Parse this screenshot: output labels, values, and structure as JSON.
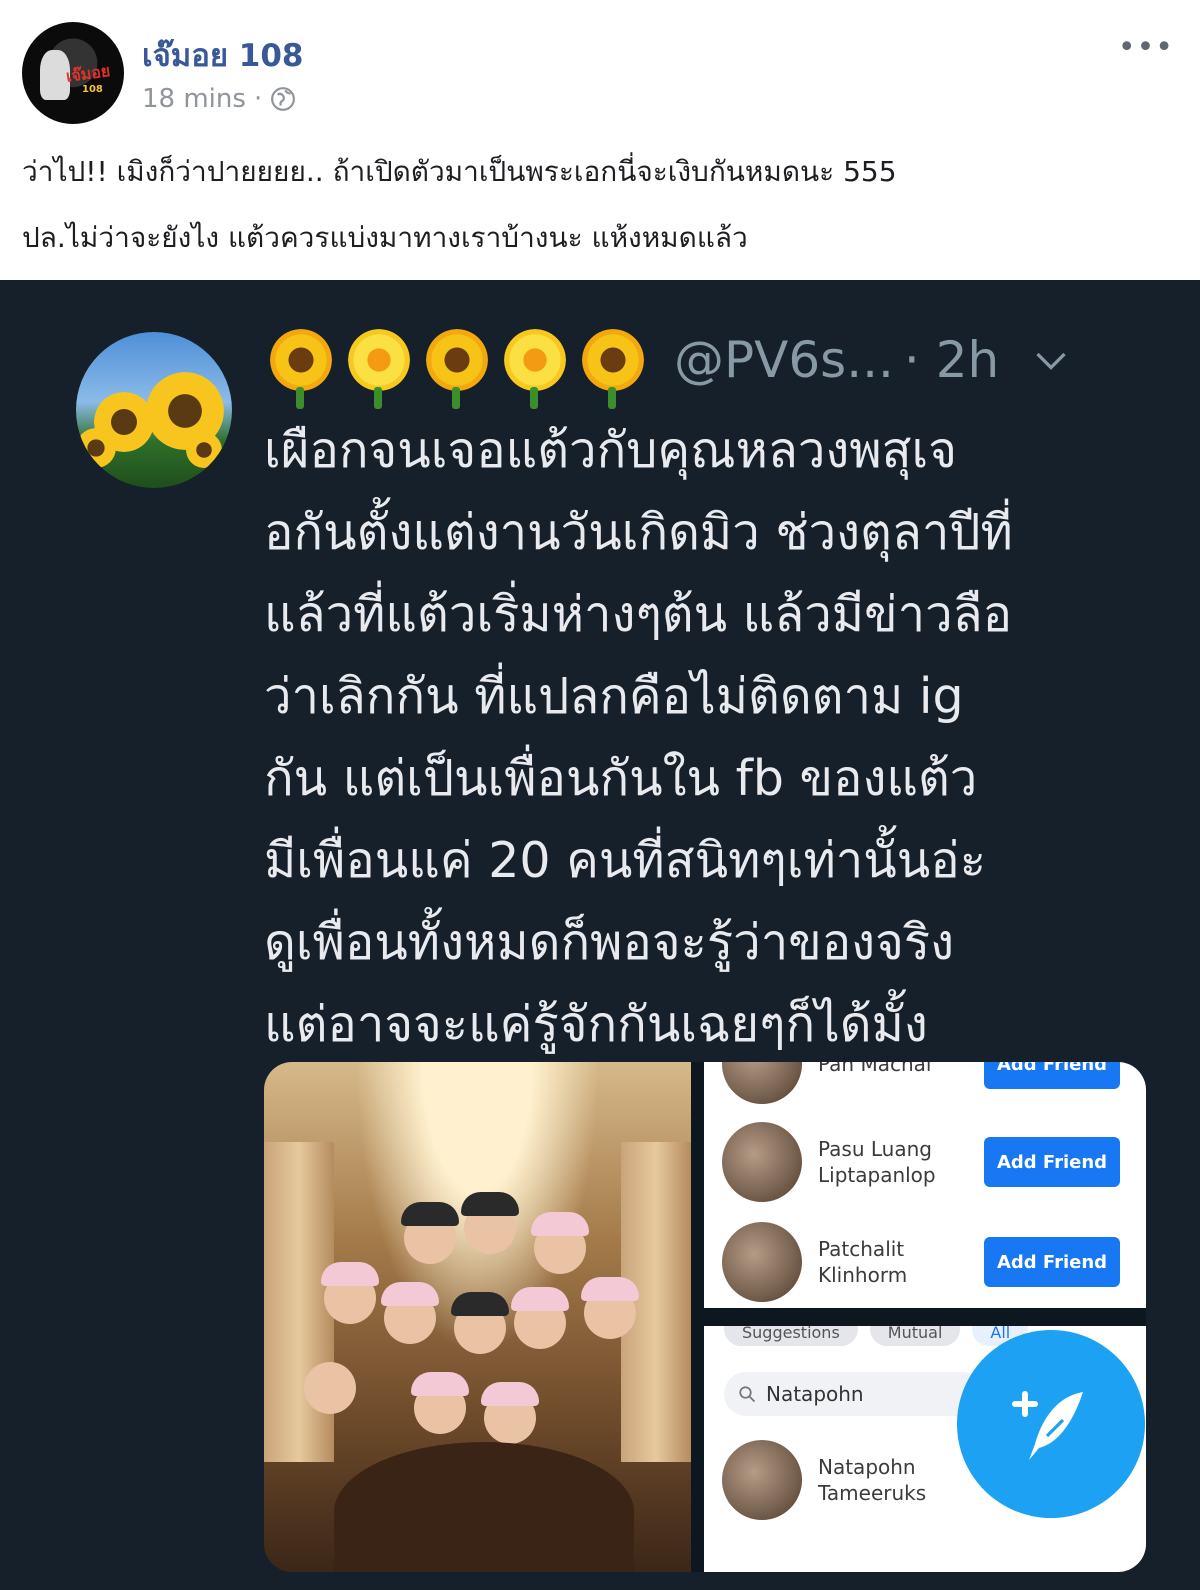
{
  "post": {
    "author": "เจ๊มอย 108",
    "time": "18 mins",
    "time_separator": "·",
    "avatar_logo_text": "เจ๊มอย",
    "more_label": "•••",
    "text_line1": "ว่าไป!! เมิงก็ว่าปายยยย.. ถ้าเปิดตัวมาเป็นพระเอกนี่จะเงิบกันหมดนะ 555",
    "text_line2": "ปล.ไม่ว่าจะยังไง แต้วควรแบ่งมาทางเราบ้างนะ แห้งหมดแล้ว"
  },
  "tweet": {
    "handle": "@PV6s...",
    "time": "· 2h",
    "emoji_names": [
      "sunflower",
      "blossom",
      "sunflower",
      "blossom",
      "sunflower"
    ],
    "lines": [
      "เผือกจนเจอแต้วกับคุณหลวงพสุเจ",
      "อกันตั้งแต่งานวันเกิดมิว ช่วงตุลาปีที่",
      "แล้วที่แต้วเริ่มห่างๆต้น แล้วมีข่าวลือ",
      "ว่าเลิกกัน ที่แปลกคือไม่ติดตาม ig",
      "กัน แต่เป็นเพื่อนกันใน fb ของแต้ว",
      "มีเพื่อนแค่ 20 คนที่สนิทๆเท่านั้นอ่ะ",
      "ดูเพื่อนทั้งหมดก็พอจะรู้ว่าของจริง",
      "แต่อาจจะแค่รู้จักกันเฉยๆก็ได้มั้ง"
    ],
    "friends_top": [
      {
        "name": "Pan Machai",
        "button": "Add Friend"
      },
      {
        "name": "Pasu Luang Liptapanlop",
        "button": "Add Friend"
      },
      {
        "name": "Patchalit Klinhorm",
        "button": "Add Friend"
      }
    ],
    "tabs": [
      "Suggestions",
      "Mutual",
      "All"
    ],
    "search_query": "Natapohn",
    "search_result": "Natapohn Tameeruks"
  },
  "colors": {
    "fb_link": "#385898",
    "tweet_bg": "#15202b",
    "twitter_blue": "#1da1f2",
    "fb_button": "#1877f2"
  },
  "icons": {
    "privacy": "globe-icon",
    "menu": "more-icon",
    "tweet_menu": "chevron-down-icon",
    "compose": "compose-tweet-icon",
    "search": "search-icon"
  }
}
